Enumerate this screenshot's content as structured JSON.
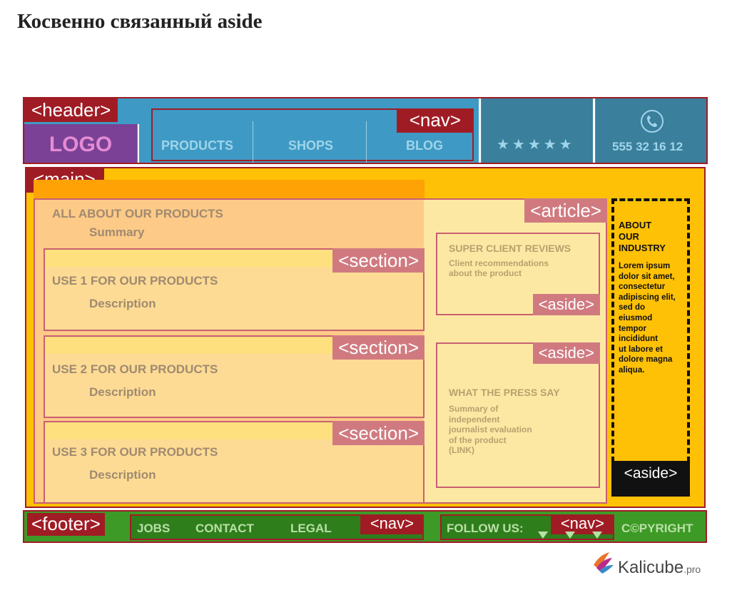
{
  "title": "Косвенно связанный aside",
  "header": {
    "tag": "<header>",
    "logo": "LOGO",
    "nav_tag": "<nav>",
    "nav_items": [
      "PRODUCTS",
      "SHOPS",
      "BLOG"
    ],
    "stars": "★★★★★",
    "phone_icon": "telephone-icon",
    "phone": "555 32 16 12"
  },
  "main": {
    "tag": "<main>",
    "article_tag": "<article>",
    "article_title": "ALL ABOUT OUR PRODUCTS",
    "article_summary": "Summary",
    "section_tag": "<section>",
    "sections": [
      {
        "title": "USE 1 FOR OUR PRODUCTS",
        "desc": "Description"
      },
      {
        "title": "USE 2 FOR OUR PRODUCTS",
        "desc": "Description"
      },
      {
        "title": "USE 3 FOR OUR PRODUCTS",
        "desc": "Description"
      }
    ],
    "aside_tag": "<aside>",
    "review": {
      "title": "SUPER CLIENT REVIEWS",
      "lines": [
        "Client recommendations",
        "about the product"
      ]
    },
    "press": {
      "title": "WHAT THE PRESS SAY",
      "lines": [
        "Summary of",
        "independent",
        "journalist evaluation",
        "of the product",
        "(LINK)"
      ]
    },
    "industry": {
      "title_lines": [
        "ABOUT",
        "OUR",
        "INDUSTRY"
      ],
      "body_lines": [
        "Lorem ipsum",
        "dolor sit amet,",
        "consectetur",
        "adipiscing elit,",
        "sed do",
        "eiusmod",
        "tempor",
        "incididunt",
        "ut labore et",
        "dolore magna",
        "aliqua."
      ]
    }
  },
  "footer": {
    "tag": "<footer>",
    "nav_tag": "<nav>",
    "links": [
      "JOBS",
      "CONTACT",
      "LEGAL"
    ],
    "follow": "FOLLOW US:",
    "copyright": "C©PYRIGHT"
  },
  "brand": {
    "name": "Kalicube",
    "suffix": ".pro"
  },
  "colors": {
    "header_blue": "#3e9ac4",
    "header_dark": "#3a7f9c",
    "logo_purple": "#7a4196",
    "main_yellow": "#fec106",
    "footer_green": "#3d9a26",
    "tag_red": "#a01c25",
    "tag_pink": "#d07a80"
  }
}
